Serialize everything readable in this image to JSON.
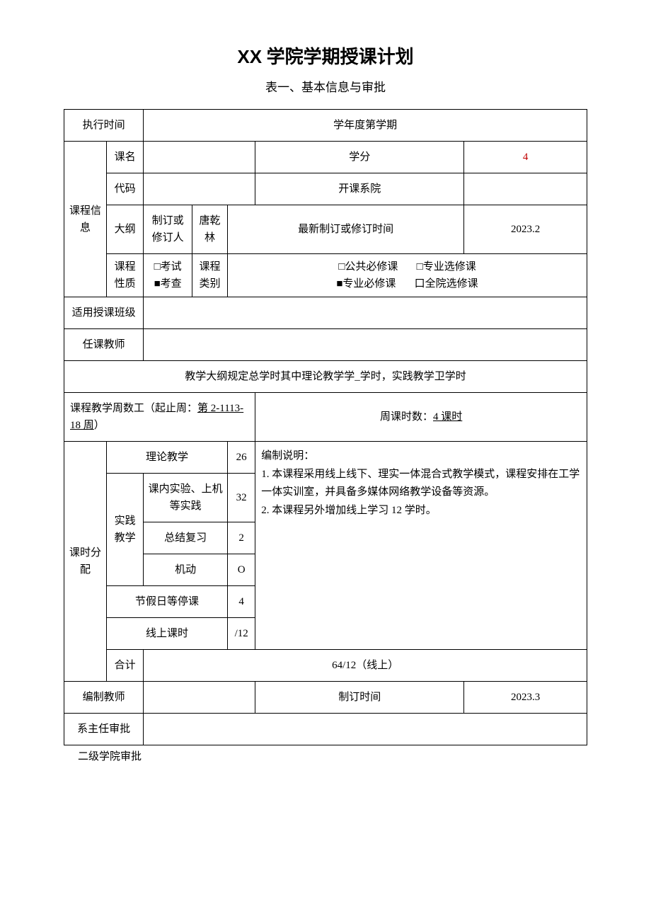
{
  "title_prefix": "XX",
  "title_suffix": " 学院学期授课计划",
  "subtitle": "表一、基本信息与审批",
  "labels": {
    "exec_time": "执行时间",
    "semester": "学年度第学期",
    "course_info": "课程信息",
    "course_name": "课名",
    "credit": "学分",
    "code": "代码",
    "department": "开课系院",
    "outline": "大纲",
    "reviser": "制订或修订人",
    "reviser_name": "唐乾林",
    "latest_revision": "最新制订或修订时间",
    "latest_revision_val": "2023.2",
    "course_nature": "课程性质",
    "exam": "□考试",
    "check": "■考查",
    "course_category": "课程类别",
    "public_required": "□公共必修课",
    "major_elective": "□专业选修课",
    "major_required": "■专业必修课",
    "college_elective": "口全院选修课",
    "applicable_class": "适用授课班级",
    "instructor": "任课教师",
    "syllabus_hours": "教学大纲规定总学时其中理论教学学_学时，实践教学卫学时",
    "teaching_weeks_prefix": "课程教学周数工（起止周：",
    "teaching_weeks_val": "第 2-1113-18 周",
    "teaching_weeks_suffix": "）",
    "weekly_hours_prefix": "周课时数：",
    "weekly_hours_val": "4 课时",
    "hour_distribution": "课时分配",
    "theory_teaching": "理论教学",
    "theory_val": "26",
    "practice_teaching": "实践教学",
    "lab_practice": "课内实验、上机等实践",
    "lab_val": "32",
    "review": "总结复习",
    "review_val": "2",
    "flexible": "机动",
    "flexible_val": "O",
    "holiday": "节假日等停课",
    "holiday_val": "4",
    "online_hours": "线上课时",
    "online_val": "/12",
    "total": "合计",
    "total_val": "64/12（线上）",
    "desc": "编制说明：\n1. 本课程采用线上线下、理实一体混合式教学模式，课程安排在工学一体实训室，并具备多媒体网络教学设备等资源。\n2. 本课程另外增加线上学习 12 学时。",
    "compiling_teacher": "编制教师",
    "compile_time": "制订时间",
    "compile_time_val": "2023.3",
    "dept_head_approval": "系主任审批",
    "college_approval": "二级学院审批"
  },
  "credit_val": "4"
}
